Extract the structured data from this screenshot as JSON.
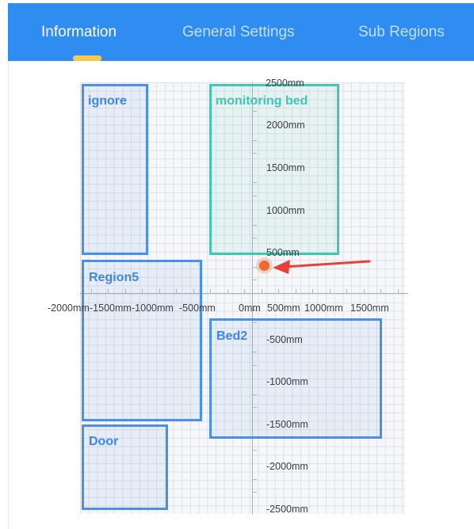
{
  "tabs": [
    {
      "label": "Information",
      "active": true
    },
    {
      "label": "General Settings",
      "active": false
    },
    {
      "label": "Sub Regions",
      "active": false
    }
  ],
  "colors": {
    "header": "#2f8cf0",
    "indicator": "#f7c948",
    "region": "#4a8fec",
    "region_alt": "#3fc7b1",
    "target": "#ef6a2e",
    "arrow": "#e8413a"
  },
  "map": {
    "x_labels": [
      "-2000mm",
      "-1500mm",
      "-1000mm",
      "-500mm",
      "0mm",
      "500mm",
      "1000mm",
      "1500mm"
    ],
    "y_labels": [
      "2500mm",
      "2000mm",
      "1500mm",
      "1000mm",
      "500mm",
      "-500mm",
      "-1000mm",
      "-1500mm",
      "-2000mm",
      "-2500mm"
    ],
    "regions": {
      "ignore": "ignore",
      "monitoring_bed": "monitoring bed",
      "region5": "Region5",
      "bed2": "Bed2",
      "door": "Door"
    },
    "target_icon": "person-dot-icon",
    "pointer_icon": "red-arrow-icon"
  }
}
